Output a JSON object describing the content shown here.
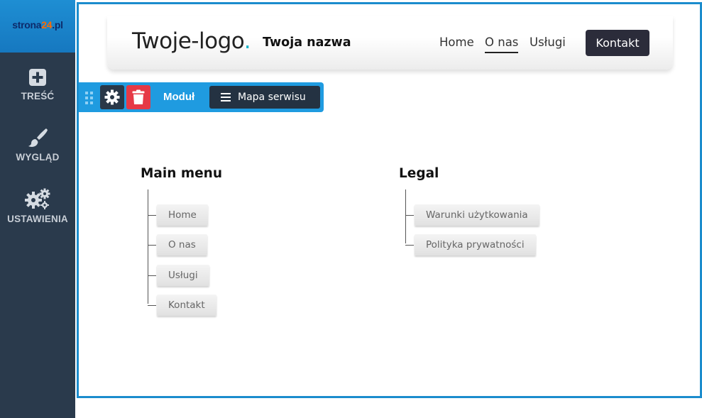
{
  "sidebar": {
    "brand": {
      "prefix": "strona",
      "accent": "24",
      "suffix": ".pl"
    },
    "items": [
      {
        "label": "TREŚĆ",
        "icon": "plus-square-icon"
      },
      {
        "label": "WYGLĄD",
        "icon": "paintbrush-icon"
      },
      {
        "label": "USTAWIENIA",
        "icon": "gears-icon"
      }
    ]
  },
  "site_header": {
    "logo_text": "Twoje-logo",
    "logo_dot": ".",
    "site_name": "Twoja nazwa",
    "nav": [
      {
        "label": "Home",
        "active": false
      },
      {
        "label": "O nas",
        "active": true
      },
      {
        "label": "Usługi",
        "active": false
      }
    ],
    "contact_button": "Kontakt"
  },
  "module_toolbar": {
    "label": "Moduł",
    "selected_module": "Mapa serwisu",
    "icons": [
      "drag-handle-icon",
      "gear-icon",
      "trash-icon",
      "hamburger-icon"
    ]
  },
  "sitemap": {
    "columns": [
      {
        "title": "Main menu",
        "items": [
          "Home",
          "O nas",
          "Usługi",
          "Kontakt"
        ]
      },
      {
        "title": "Legal",
        "items": [
          "Warunki użytkowania",
          "Polityka prywatności"
        ]
      }
    ]
  },
  "colors": {
    "sidebar_bg": "#2a3a4c",
    "brand_bg": "#1678c0",
    "frame_border": "#1b8ccd",
    "module_bar": "#1f9be0",
    "trash_red": "#e63946",
    "logo_dot": "#1ab3c9",
    "contact_button": "#2b2c3a"
  }
}
